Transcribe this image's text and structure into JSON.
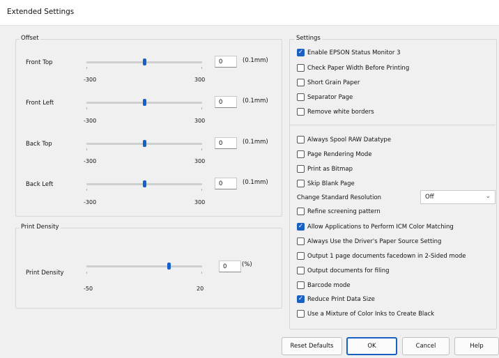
{
  "window": {
    "title": "Extended Settings"
  },
  "offset": {
    "label": "Offset",
    "rows": [
      {
        "label": "Front Top",
        "value": "0",
        "unit": "(0.1mm)",
        "min": "-300",
        "max": "300",
        "level": 0
      },
      {
        "label": "Front Left",
        "value": "0",
        "unit": "(0.1mm)",
        "min": "-300",
        "max": "300",
        "level": 0
      },
      {
        "label": "Back Top",
        "value": "0",
        "unit": "(0.1mm)",
        "min": "-300",
        "max": "300",
        "level": 0
      },
      {
        "label": "Back Left",
        "value": "0",
        "unit": "(0.1mm)",
        "min": "-300",
        "max": "300",
        "level": 0
      }
    ]
  },
  "density": {
    "label": "Print Density",
    "row": {
      "label": "Print Density",
      "value": "0",
      "unit": "(%)",
      "min": "-50",
      "max": "20",
      "level": 0
    }
  },
  "settings": {
    "label": "Settings",
    "items": [
      {
        "label": "Enable EPSON Status Monitor 3",
        "checked": true
      },
      {
        "label": "Check Paper Width Before Printing",
        "checked": false
      },
      {
        "label": "Short Grain Paper",
        "checked": false
      },
      {
        "label": "Separator Page",
        "checked": false
      },
      {
        "label": "Remove white borders",
        "checked": false
      },
      {
        "label": "Always Spool RAW Datatype",
        "checked": false
      },
      {
        "label": "Page Rendering Mode",
        "checked": false
      },
      {
        "label": "Print as Bitmap",
        "checked": false
      },
      {
        "label": "Skip Blank Page",
        "checked": false
      },
      {
        "label": "Refine screening pattern",
        "checked": false
      },
      {
        "label": "Allow Applications to Perform ICM Color Matching",
        "checked": true
      },
      {
        "label": "Always Use the Driver's Paper Source Setting",
        "checked": false
      },
      {
        "label": "Output 1 page documents facedown in 2-Sided mode",
        "checked": false
      },
      {
        "label": "Output documents for filing",
        "checked": false
      },
      {
        "label": "Barcode mode",
        "checked": false
      },
      {
        "label": "Reduce Print Data Size",
        "checked": true
      },
      {
        "label": "Use a Mixture of Color Inks to Create Black",
        "checked": false
      }
    ],
    "resolution": {
      "label": "Change Standard Resolution",
      "value": "Off"
    }
  },
  "buttons": {
    "reset": "Reset Defaults",
    "ok": "OK",
    "cancel": "Cancel",
    "help": "Help"
  },
  "colors": {
    "accent": "#1a5fc2",
    "background": "#f0f0f0"
  }
}
